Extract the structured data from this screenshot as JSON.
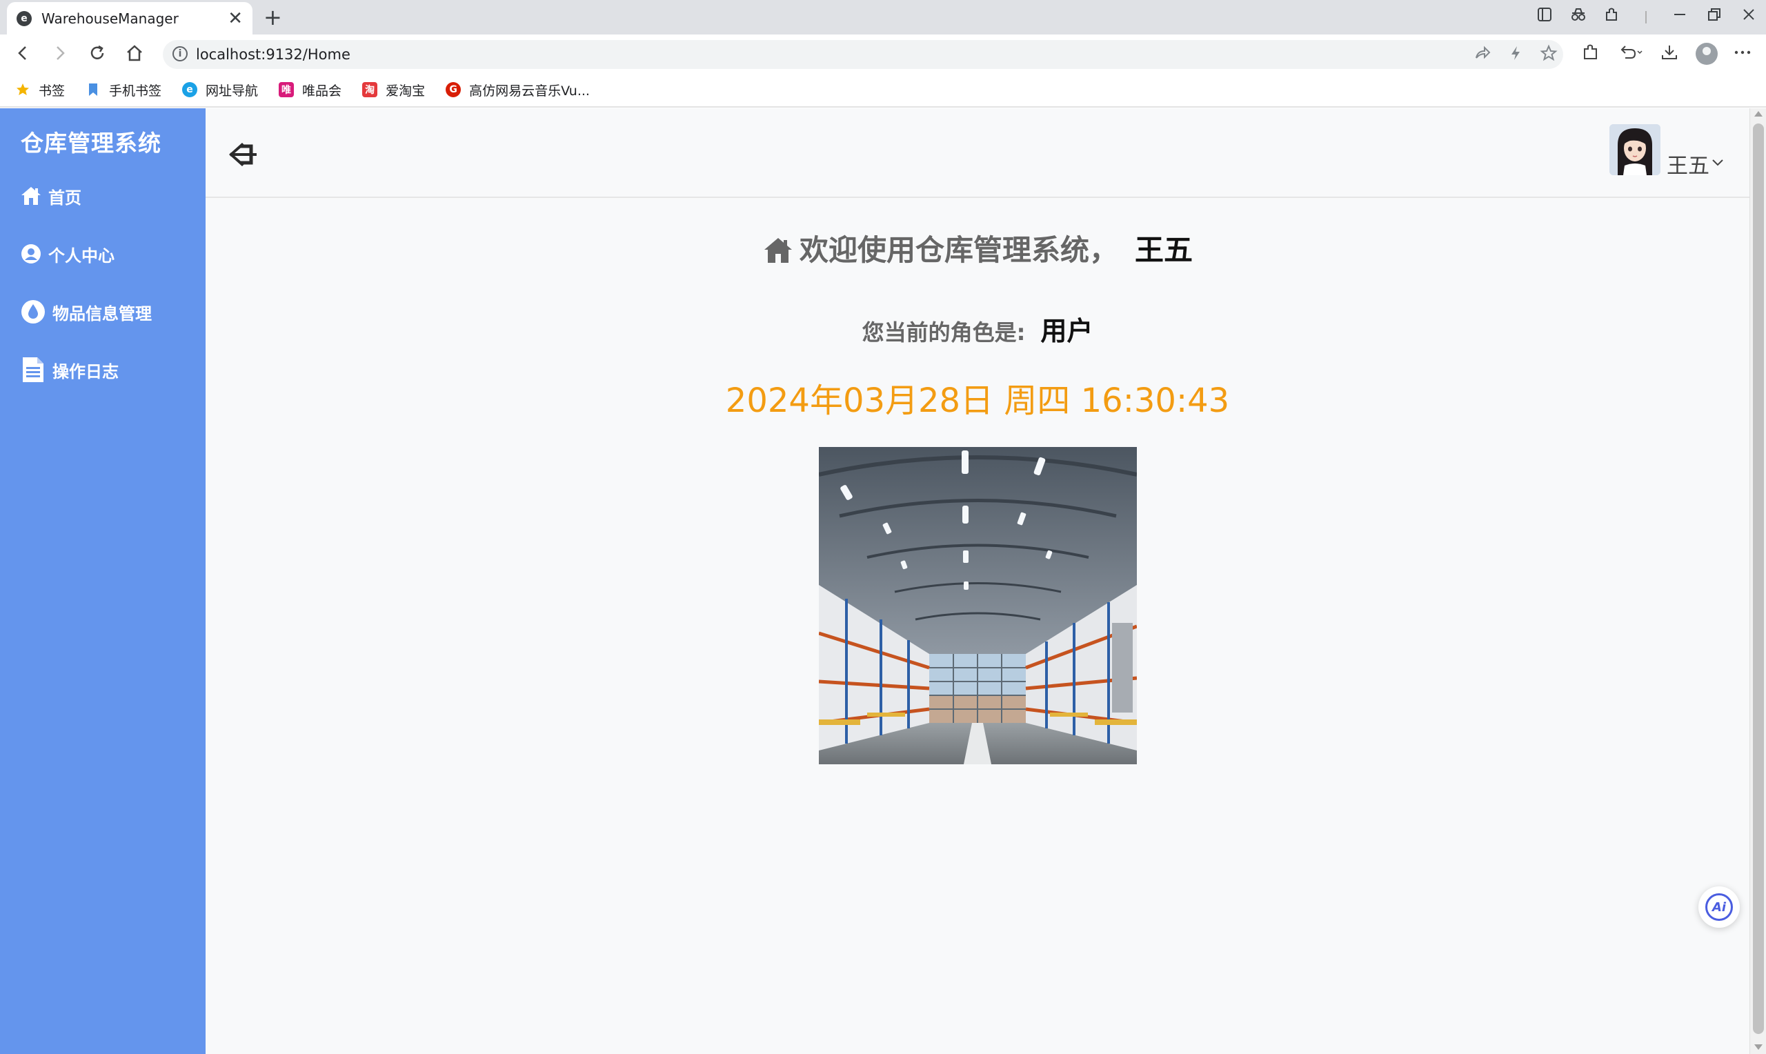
{
  "browser": {
    "tab_title": "WarehouseManager",
    "tab_close": "✕",
    "new_tab": "+",
    "url": "localhost:9132/Home",
    "bookmarks": [
      {
        "label": "书签",
        "icon": "star-icon",
        "color": "#f4b400"
      },
      {
        "label": "手机书签",
        "icon": "bookmark-icon",
        "color": "#4a90e2"
      },
      {
        "label": "网址导航",
        "icon": "navigation-icon",
        "color": "#1aa1e6"
      },
      {
        "label": "唯品会",
        "icon": "vipshop-icon",
        "color": "#d81b7a"
      },
      {
        "label": "爱淘宝",
        "icon": "aitaobao-icon",
        "color": "#e4393c"
      },
      {
        "label": "高仿网易云音乐Vu...",
        "icon": "netease-music-icon",
        "color": "#d81e06"
      }
    ]
  },
  "app": {
    "system_title": "仓库管理系统",
    "menu": [
      {
        "label": "首页",
        "icon": "home-icon"
      },
      {
        "label": "个人中心",
        "icon": "user-circle-icon"
      },
      {
        "label": "物品信息管理",
        "icon": "droplet-icon"
      },
      {
        "label": "操作日志",
        "icon": "document-icon"
      }
    ],
    "user": {
      "name": "王五",
      "caret": "⌵"
    },
    "welcome_text": "欢迎使用仓库管理系统，",
    "welcome_name": "王五",
    "role_label": "您当前的角色是:",
    "role_value": "用户",
    "datetime": "2024年03月28日 周四 16:30:43",
    "ai_button": "Ai"
  },
  "colors": {
    "sidebar": "#6495ed",
    "datetime": "#f39c12",
    "main_bg": "#f8f9fa"
  }
}
